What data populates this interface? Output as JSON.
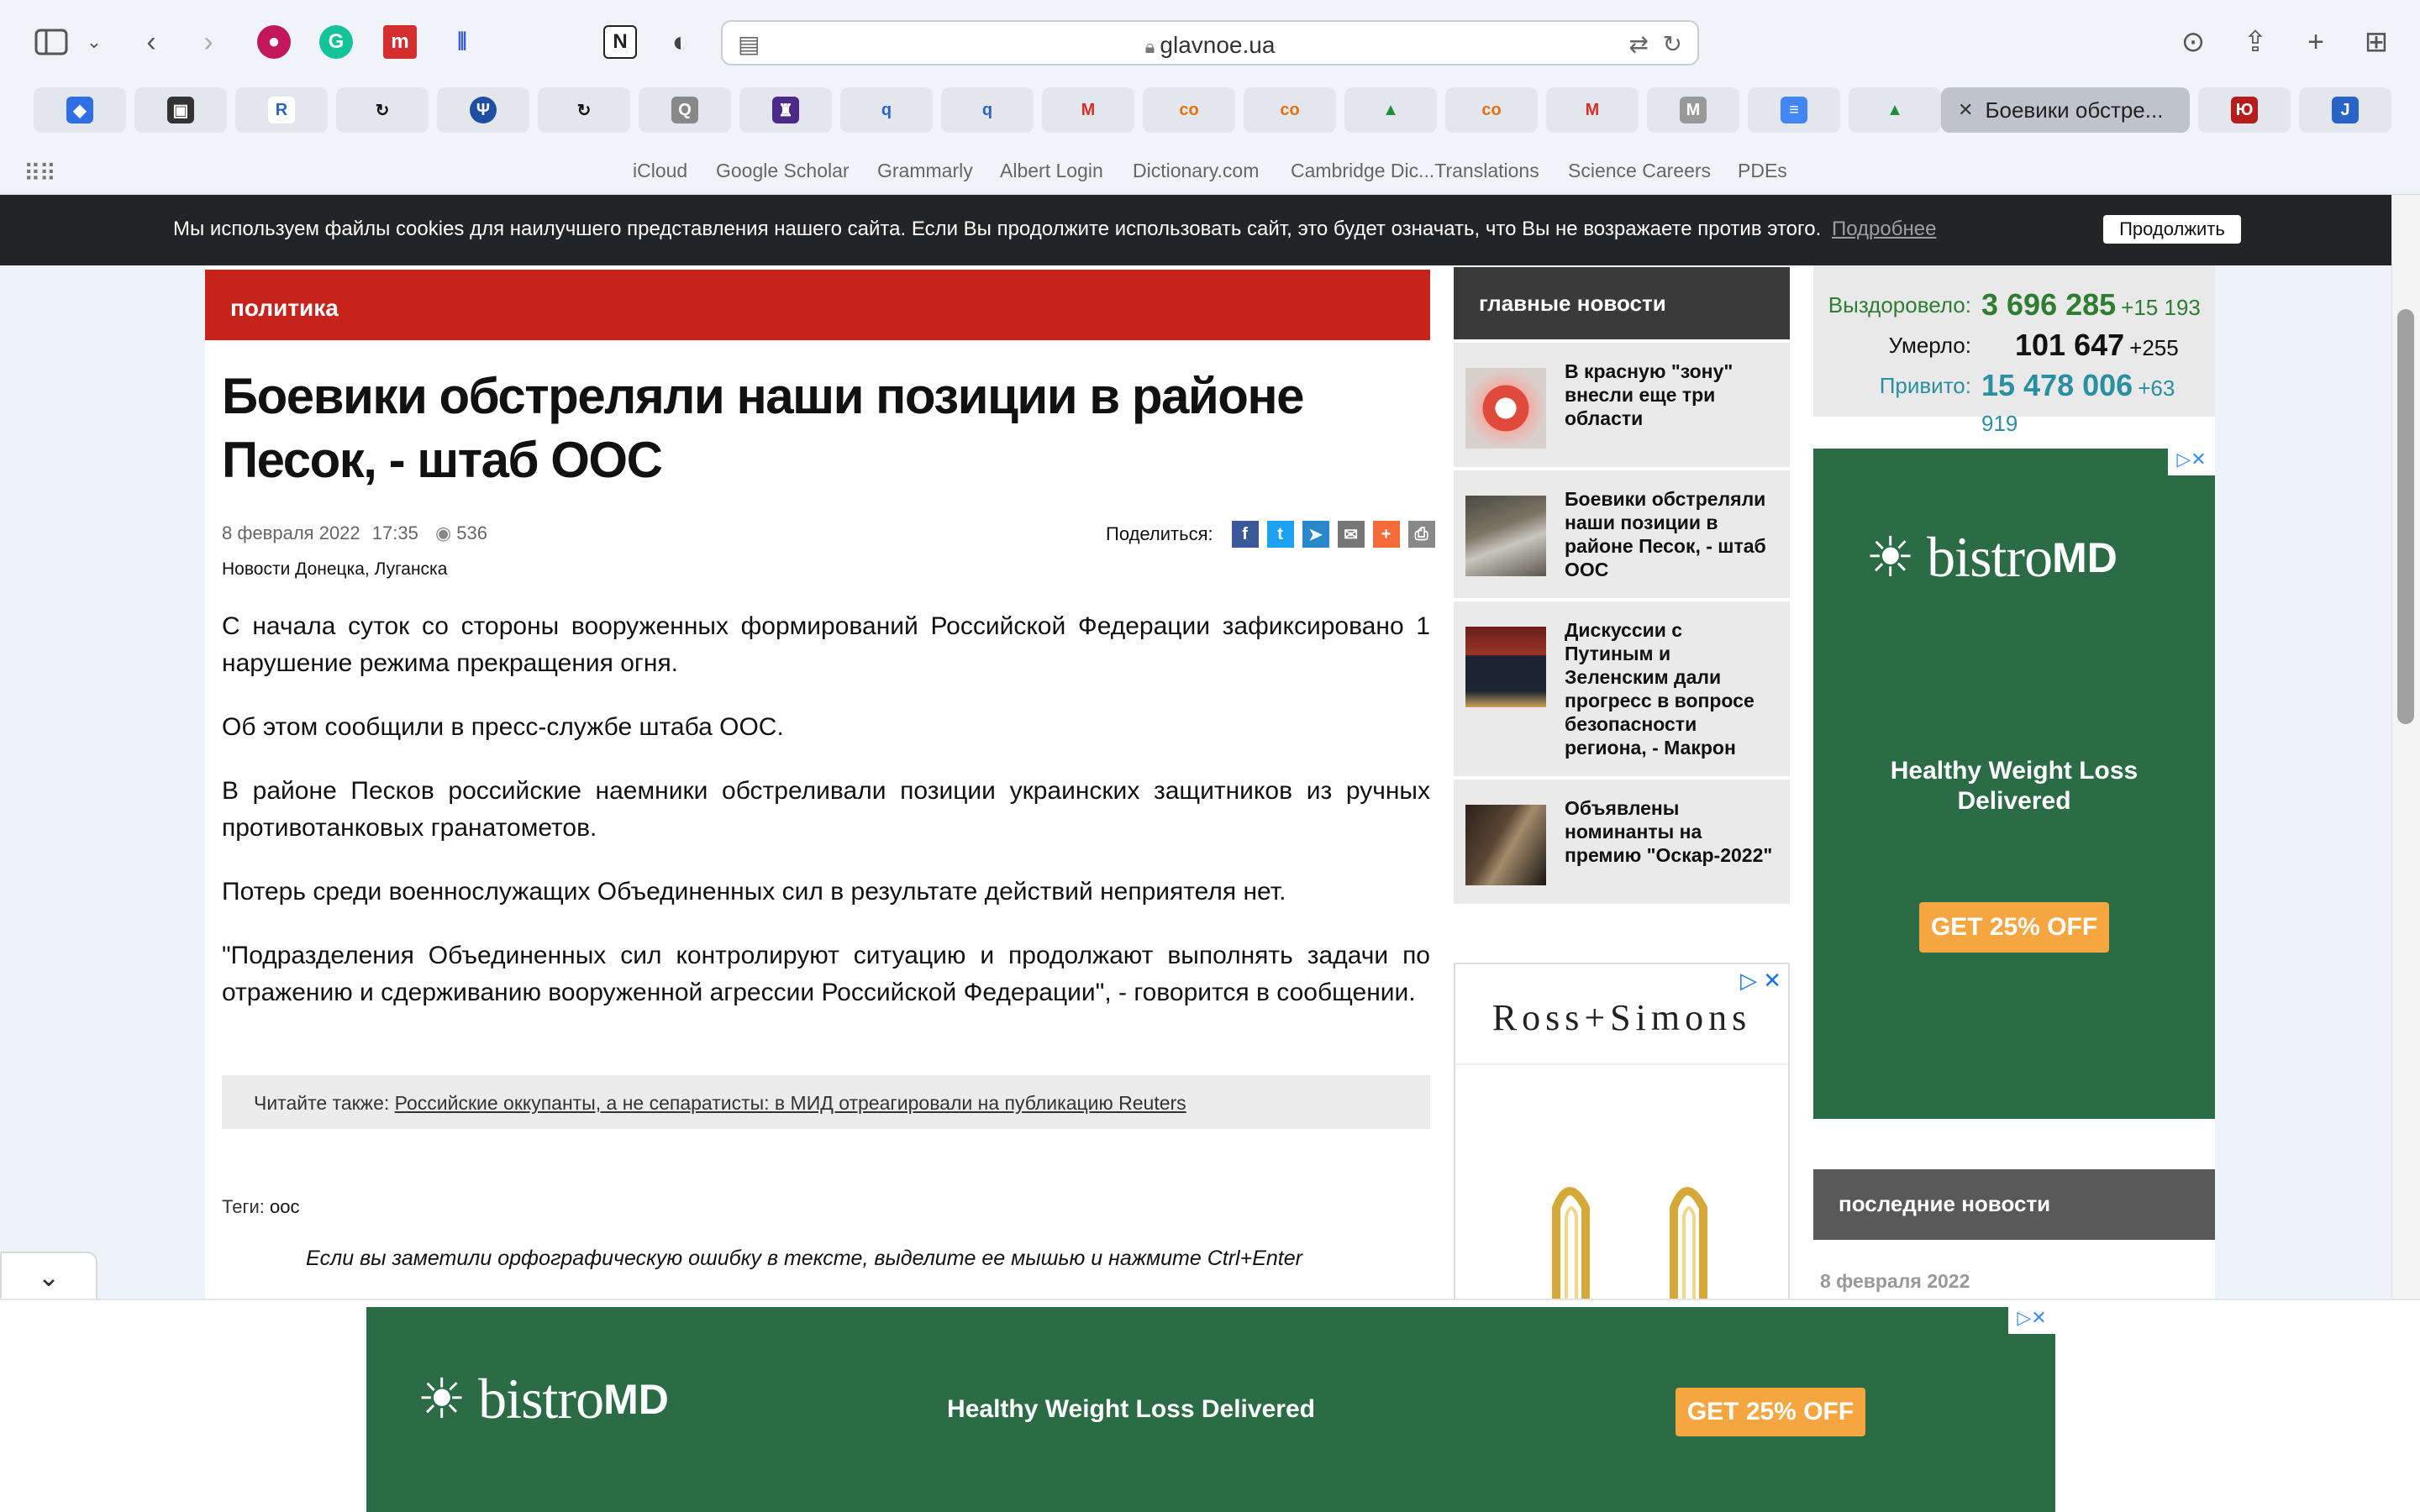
{
  "browser": {
    "url": "glavnoe.ua",
    "active_tab_title": "Боевики обстре...",
    "bookmarks": [
      "iCloud",
      "Google Scholar",
      "Grammarly",
      "Albert Login",
      "Dictionary.com",
      "Cambridge Dic...Translations",
      "Science Careers",
      "PDEs"
    ]
  },
  "cookie": {
    "message": "Мы используем файлы cookies для наилучшего представления нашего сайта. Если Вы продолжите использовать сайт, это будет означать, что Вы не возражаете против этого.",
    "more_link": "Подробнее",
    "continue_button": "Продолжить"
  },
  "article": {
    "section": "политика",
    "headline": "Боевики обстреляли наши позиции в районе Песок, - штаб ООС",
    "date": "8 февраля 2022",
    "time": "17:35",
    "views": "536",
    "region": "Новости Донецка, Луганска",
    "share_label": "Поделиться:",
    "paragraphs": [
      "С начала суток со стороны вооруженных формирований Российской Федерации зафиксировано 1 нарушение режима прекращения огня.",
      "Об этом сообщили в пресс-службе штаба ООС.",
      "В районе Песков российские наемники обстреливали позиции украинских защитников из ручных противотанковых гранатометов.",
      "Потерь среди военнослужащих Объединенных сил в результате действий неприятеля нет.",
      "\"Подразделения Объединенных сил контролируют ситуацию и продолжают выполнять задачи по отражению и сдерживанию вооруженной агрессии Российской Федерации\", - говорится в сообщении."
    ],
    "see_also_label": "Читайте также:",
    "see_also_link": "Российские оккупанты, а не сепаратисты: в МИД отреагировали на публикацию Reuters",
    "tags_label": "Теги:",
    "tag": "оос",
    "typo_note": "Если вы заметили орфографическую ошибку в тексте, выделите ее мышью и нажмите Ctrl+Enter"
  },
  "main_news": {
    "header": "главные новости",
    "items": [
      {
        "title": "В красную \"зону\" внесли еще три области"
      },
      {
        "title": "Боевики обстреляли наши позиции в районе Песок, - штаб ООС"
      },
      {
        "title": "Дискуссии с Путиным и Зеленским дали прогресс в вопросе безопасности региона, - Макрон"
      },
      {
        "title": "Объявлены номинанты на премию \"Оскар-2022\""
      }
    ]
  },
  "covid": {
    "recovered_label": "Выздоровело:",
    "recovered": "3 696 285",
    "recovered_delta": "+15 193",
    "died_label": "Умерло:",
    "died": "101 647",
    "died_delta": "+255",
    "vaccinated_label": "Привито:",
    "vaccinated": "15 478 006",
    "vaccinated_delta": "+63 919"
  },
  "ads": {
    "bistro_brand_1": "bistro",
    "bistro_brand_2": "MD",
    "bistro_tagline": "Healthy Weight Loss Delivered",
    "bistro_cta": "GET 25% OFF",
    "ross_simons": "Ross+Simons",
    "ad_choice": "▷✕"
  },
  "latest": {
    "header": "последние новости",
    "date": "8 февраля 2022"
  },
  "colors": {
    "section_red": "#c7231a",
    "bistro_green": "#2b6c47",
    "cta_orange": "#f5a640"
  }
}
